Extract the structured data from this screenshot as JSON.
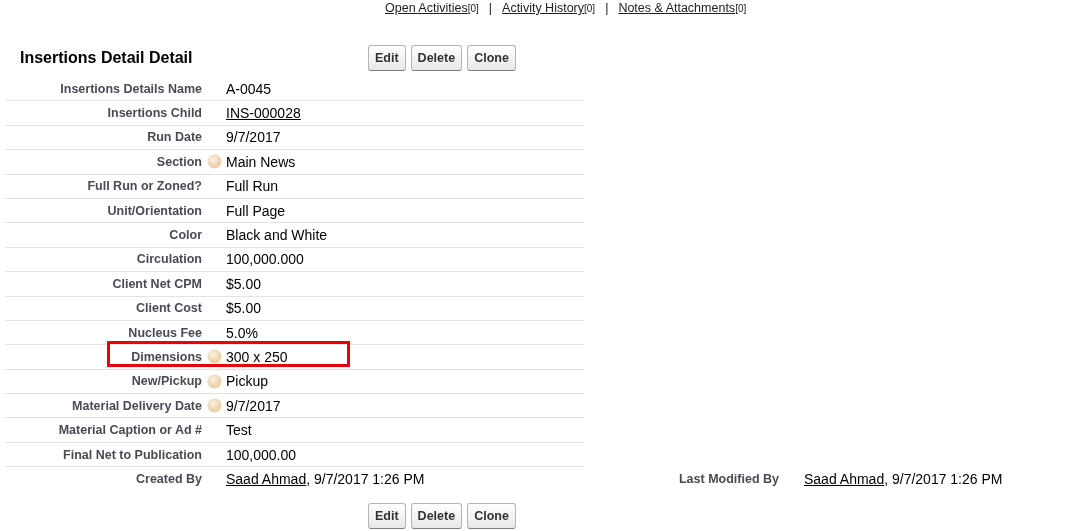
{
  "related_links": {
    "separator": "|",
    "items": [
      {
        "label": "Open Activities",
        "count": "[0]"
      },
      {
        "label": "Activity History",
        "count": "[0]"
      },
      {
        "label": "Notes & Attachments",
        "count": "[0]"
      }
    ]
  },
  "detail": {
    "title": "Insertions Detail Detail",
    "buttons": [
      "Edit",
      "Delete",
      "Clone"
    ],
    "rows": [
      {
        "label": "Insertions Details Name",
        "value": "A-0045",
        "kind": "text",
        "help": false,
        "highlighted": false
      },
      {
        "label": "Insertions Child",
        "value": "INS-000028",
        "kind": "link",
        "help": false,
        "highlighted": false
      },
      {
        "label": "Run Date",
        "value": "9/7/2017",
        "kind": "text",
        "help": false,
        "highlighted": false
      },
      {
        "label": "Section",
        "value": "Main News",
        "kind": "text",
        "help": true,
        "highlighted": false
      },
      {
        "label": "Full Run or Zoned?",
        "value": "Full Run",
        "kind": "text",
        "help": false,
        "highlighted": false
      },
      {
        "label": "Unit/Orientation",
        "value": "Full Page",
        "kind": "text",
        "help": false,
        "highlighted": false
      },
      {
        "label": "Color",
        "value": "Black and White",
        "kind": "text",
        "help": false,
        "highlighted": false
      },
      {
        "label": "Circulation",
        "value": "100,000.000",
        "kind": "text",
        "help": false,
        "highlighted": false
      },
      {
        "label": "Client Net CPM",
        "value": "$5.00",
        "kind": "text",
        "help": false,
        "highlighted": false
      },
      {
        "label": "Client Cost",
        "value": "$5.00",
        "kind": "text",
        "help": false,
        "highlighted": false
      },
      {
        "label": "Nucleus Fee",
        "value": "5.0%",
        "kind": "text",
        "help": false,
        "highlighted": false
      },
      {
        "label": "Dimensions",
        "value": "300 x 250",
        "kind": "text",
        "help": true,
        "highlighted": true
      },
      {
        "label": "New/Pickup",
        "value": "Pickup",
        "kind": "text",
        "help": true,
        "highlighted": false
      },
      {
        "label": "Material Delivery Date",
        "value": "9/7/2017",
        "kind": "text",
        "help": true,
        "highlighted": false
      },
      {
        "label": "Material Caption or Ad #",
        "value": "Test",
        "kind": "text",
        "help": false,
        "highlighted": false
      },
      {
        "label": "Final Net to Publication",
        "value": "100,000.00",
        "kind": "text",
        "help": false,
        "highlighted": false
      }
    ],
    "audit": [
      {
        "label": "Created By",
        "user": "Saad Ahmad",
        "date": ", 9/7/2017 1:26 PM"
      },
      {
        "label": "Last Modified By",
        "user": "Saad Ahmad",
        "date": ", 9/7/2017 1:26 PM"
      }
    ],
    "bottom_buttons": [
      "Edit",
      "Delete",
      "Clone"
    ]
  }
}
